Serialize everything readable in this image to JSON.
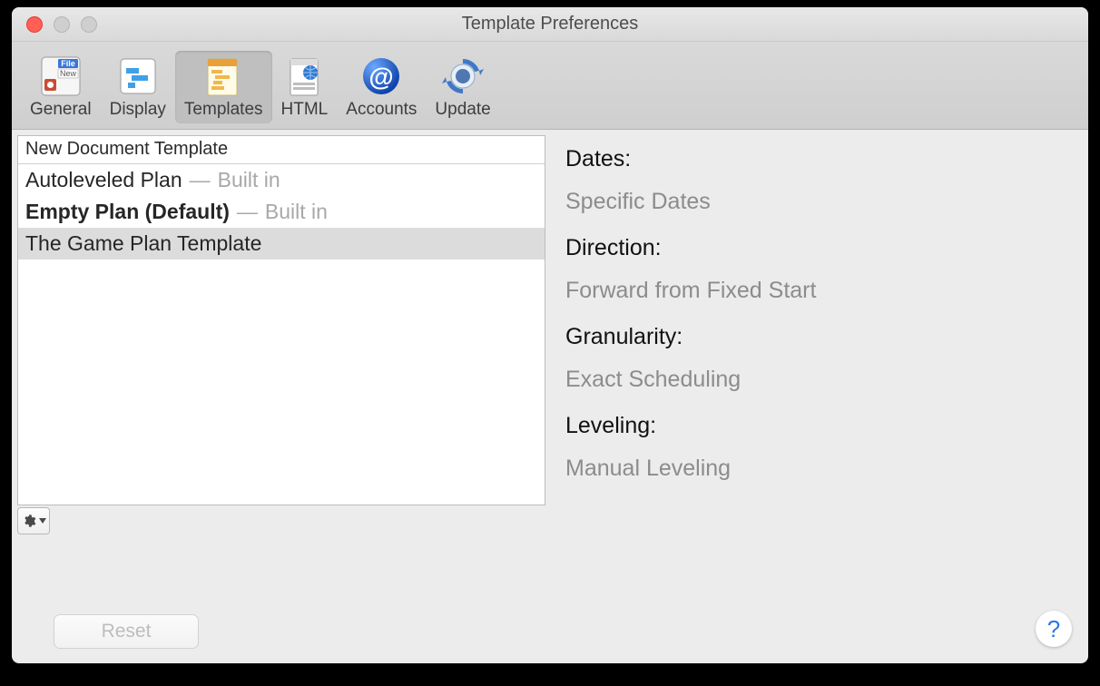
{
  "window": {
    "title": "Template Preferences"
  },
  "toolbar": {
    "tabs": [
      {
        "label": "General"
      },
      {
        "label": "Display"
      },
      {
        "label": "Templates"
      },
      {
        "label": "HTML"
      },
      {
        "label": "Accounts"
      },
      {
        "label": "Update"
      }
    ],
    "selected_index": 2
  },
  "templates_list": {
    "header": "New Document Template",
    "rows": [
      {
        "name": "Autoleveled Plan",
        "suffix": "Built in",
        "bold": false,
        "selected": false
      },
      {
        "name": "Empty Plan (Default)",
        "suffix": "Built in",
        "bold": true,
        "selected": false
      },
      {
        "name": "The Game Plan Template",
        "suffix": "",
        "bold": false,
        "selected": true
      }
    ]
  },
  "details": {
    "dates_label": "Dates:",
    "dates_value": "Specific Dates",
    "direction_label": "Direction:",
    "direction_value": "Forward from Fixed Start",
    "granularity_label": "Granularity:",
    "granularity_value": "Exact Scheduling",
    "leveling_label": "Leveling:",
    "leveling_value": "Manual Leveling"
  },
  "buttons": {
    "reset": "Reset",
    "help": "?"
  },
  "suffix_separator": "—"
}
